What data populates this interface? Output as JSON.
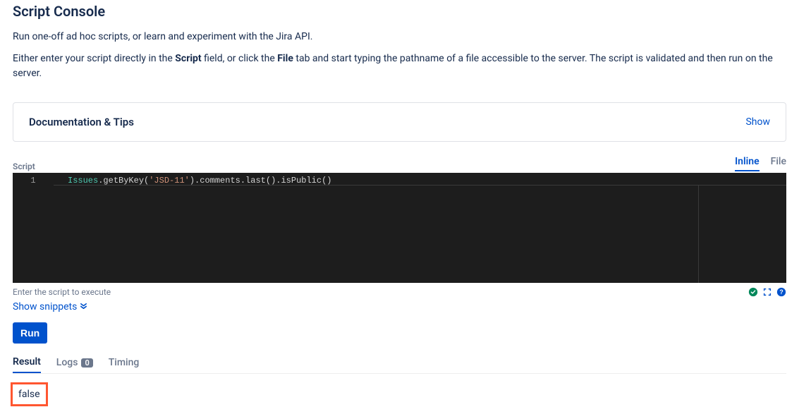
{
  "header": {
    "title": "Script Console",
    "desc1": "Run one-off ad hoc scripts, or learn and experiment with the Jira API.",
    "desc2_pre": "Either enter your script directly in the ",
    "desc2_b1": "Script",
    "desc2_mid": " field, or click the ",
    "desc2_b2": "File",
    "desc2_post": " tab and start typing the pathname of a file accessible to the server. The script is validated and then run on the server."
  },
  "docTips": {
    "label": "Documentation & Tips",
    "show": "Show"
  },
  "editor": {
    "script_label": "Script",
    "modes": {
      "inline": "Inline",
      "file": "File"
    },
    "line_no": "1",
    "code": {
      "cls": "Issues",
      "p1": ".getByKey(",
      "str": "'JSD-11'",
      "p2": ").comments.last().isPublic()"
    },
    "hint": "Enter the script to execute",
    "show_snippets": "Show snippets"
  },
  "run": {
    "label": "Run"
  },
  "tabs": {
    "result": "Result",
    "logs": "Logs",
    "logs_count": "0",
    "timing": "Timing"
  },
  "result": {
    "value": "false"
  }
}
